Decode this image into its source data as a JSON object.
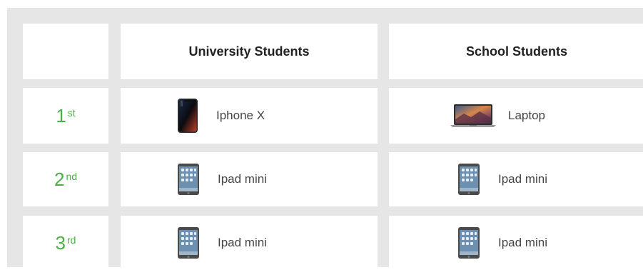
{
  "table": {
    "header": {
      "corner": "",
      "col1": "University Students",
      "col2": "School Students"
    },
    "rows": [
      {
        "rank_num": "1",
        "rank_suffix": "st",
        "university": {
          "device": "Iphone X",
          "icon": "iphone-x-icon"
        },
        "school": {
          "device": "Laptop",
          "icon": "laptop-icon"
        }
      },
      {
        "rank_num": "2",
        "rank_suffix": "nd",
        "university": {
          "device": "Ipad mini",
          "icon": "ipad-mini-icon"
        },
        "school": {
          "device": "Ipad mini",
          "icon": "ipad-mini-icon"
        }
      },
      {
        "rank_num": "3",
        "rank_suffix": "rd",
        "university": {
          "device": "Ipad mini",
          "icon": "ipad-mini-icon"
        },
        "school": {
          "device": "Ipad mini",
          "icon": "ipad-mini-icon"
        }
      }
    ]
  },
  "colors": {
    "frame": "#e6e6e6",
    "cell": "#ffffff",
    "rank": "#4cae43",
    "header_text": "#222222",
    "body_text": "#444444"
  }
}
